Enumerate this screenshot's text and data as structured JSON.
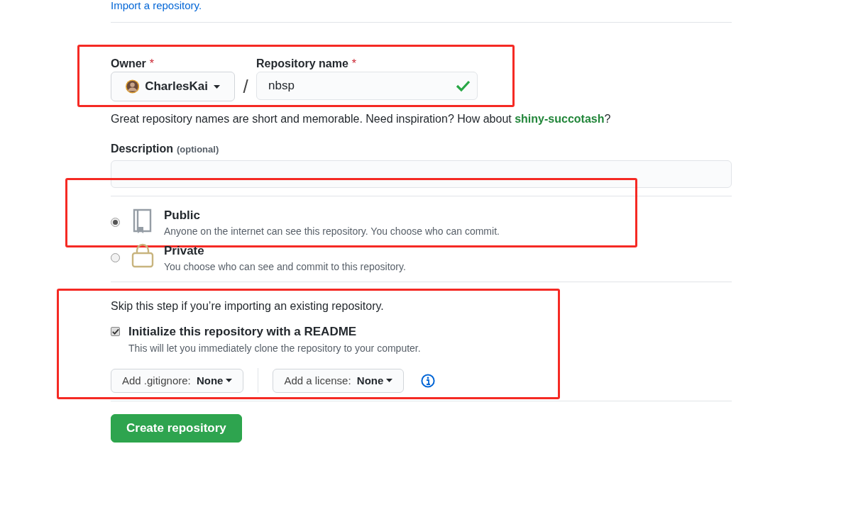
{
  "import_link": "Import a repository.",
  "name_section": {
    "highlighted": true,
    "owner": {
      "label": "Owner",
      "required_mark": "*",
      "value": "CharlesKai"
    },
    "separator": "/",
    "repository_name": {
      "label": "Repository name",
      "required_mark": "*",
      "value": "nbsp",
      "valid": true
    },
    "hint": {
      "text": "Great repository names are short and memorable. Need inspiration? How about ",
      "suggestion": "shiny-succotash",
      "end": "?"
    }
  },
  "description": {
    "label": "Description",
    "note": "(optional)"
  },
  "visibility": [
    {
      "kind": "public",
      "title": "Public",
      "description": "Anyone on the internet can see this repository. You choose who can commit.",
      "selected": true,
      "highlighted": true
    },
    {
      "kind": "private",
      "title": "Private",
      "description": "You choose who can see and commit to this repository.",
      "selected": false,
      "highlighted": false
    }
  ],
  "init": {
    "highlighted": true,
    "skip_note": "Skip this step if you’re importing an existing repository.",
    "readme": {
      "label": "Initialize this repository with a README",
      "description": "This will let you immediately clone the repository to your computer.",
      "checked": true
    },
    "gitignore": {
      "label": "Add .gitignore:",
      "value": "None"
    },
    "license": {
      "label": "Add a license:",
      "value": "None"
    }
  },
  "create_button": "Create repository"
}
